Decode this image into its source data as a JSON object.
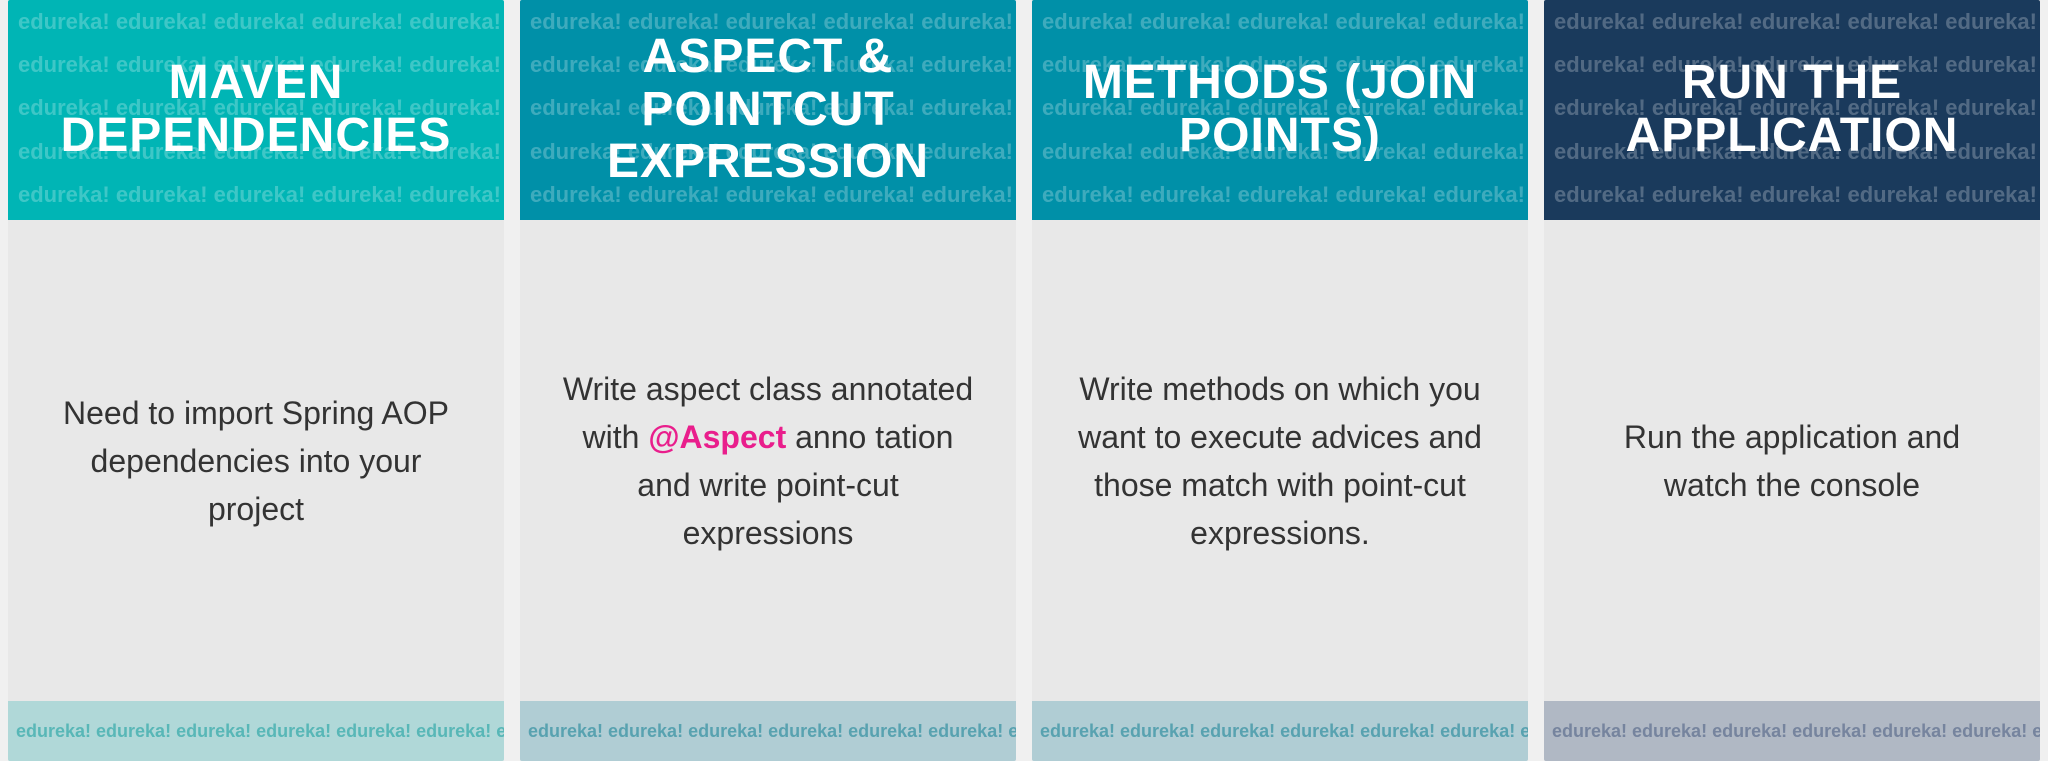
{
  "cards": [
    {
      "id": "card-1",
      "header_bg": "#00b5b5",
      "title": "MAVEN DEPENDENCIES",
      "body_text": "Need to import Spring AOP dependencies into your project",
      "body_has_highlight": false,
      "highlight_word": "",
      "watermark_word": "edureka!"
    },
    {
      "id": "card-2",
      "header_bg": "#0090a8",
      "title": "ASPECT & POINTCUT EXPRESSION",
      "body_text_parts": [
        "Write aspect class annotated with ",
        "@Aspect",
        " anno tation and write point-cut expressions"
      ],
      "body_has_highlight": true,
      "highlight_word": "@Aspect",
      "watermark_word": "edureka!"
    },
    {
      "id": "card-3",
      "header_bg": "#0090a8",
      "title": "METHODS (JOIN POINTS)",
      "body_text": "Write methods on which you want to execute advices and those match with point-cut expressions.",
      "body_has_highlight": false,
      "highlight_word": "",
      "watermark_word": "edureka!"
    },
    {
      "id": "card-4",
      "header_bg": "#1a3a5c",
      "title": "RUN THE APPLICATION",
      "body_text": "Run the application and watch the console",
      "body_has_highlight": false,
      "highlight_word": "",
      "watermark_word": "edureka!"
    }
  ],
  "watermark_repeat": "edureka!  edureka!  edureka!  edureka!  edureka!  edureka!  edureka!  edureka!  edureka!  edureka!  edureka!  edureka!  edureka!  edureka!"
}
